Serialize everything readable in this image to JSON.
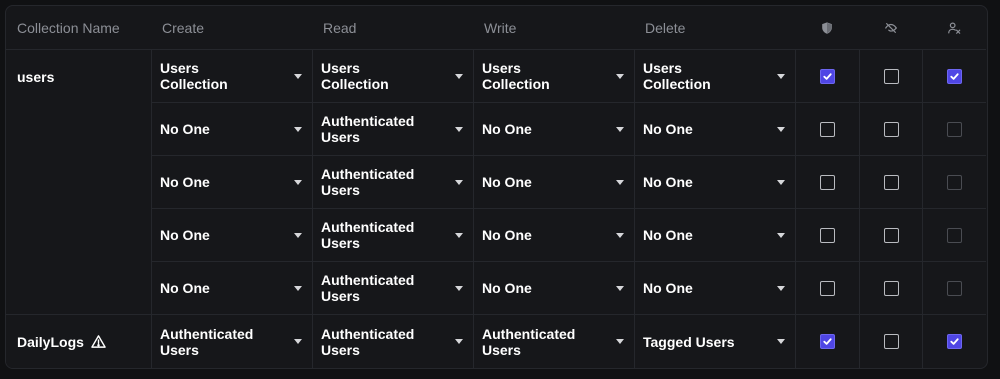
{
  "header": {
    "collection_name": "Collection Name",
    "create": "Create",
    "read": "Read",
    "write": "Write",
    "delete": "Delete",
    "icons": [
      "shield-icon",
      "eye-off-icon",
      "user-x-icon"
    ]
  },
  "collections": [
    {
      "name": "users",
      "warning": false
    },
    {
      "name": "DailyLogs",
      "warning": true
    }
  ],
  "rows": [
    {
      "create": "Users Collection",
      "read": "Users Collection",
      "write": "Users Collection",
      "delete": "Users Collection",
      "flags": [
        "checked",
        "unchecked",
        "checked"
      ]
    },
    {
      "create": "No One",
      "read": "Authenticated Users",
      "write": "No One",
      "delete": "No One",
      "flags": [
        "unchecked",
        "unchecked",
        "disabled"
      ]
    },
    {
      "create": "No One",
      "read": "Authenticated Users",
      "write": "No One",
      "delete": "No One",
      "flags": [
        "unchecked",
        "unchecked",
        "disabled"
      ]
    },
    {
      "create": "No One",
      "read": "Authenticated Users",
      "write": "No One",
      "delete": "No One",
      "flags": [
        "unchecked",
        "unchecked",
        "disabled"
      ]
    },
    {
      "create": "No One",
      "read": "Authenticated Users",
      "write": "No One",
      "delete": "No One",
      "flags": [
        "unchecked",
        "unchecked",
        "disabled"
      ]
    },
    {
      "create": "Authenticated Users",
      "read": "Authenticated Users",
      "write": "Authenticated Users",
      "delete": "Tagged Users",
      "flags": [
        "checked",
        "unchecked",
        "checked"
      ]
    }
  ],
  "colors": {
    "accent": "#4f46e5",
    "background": "#16171a",
    "border": "#25272c",
    "muted_text": "#8c8f96"
  }
}
